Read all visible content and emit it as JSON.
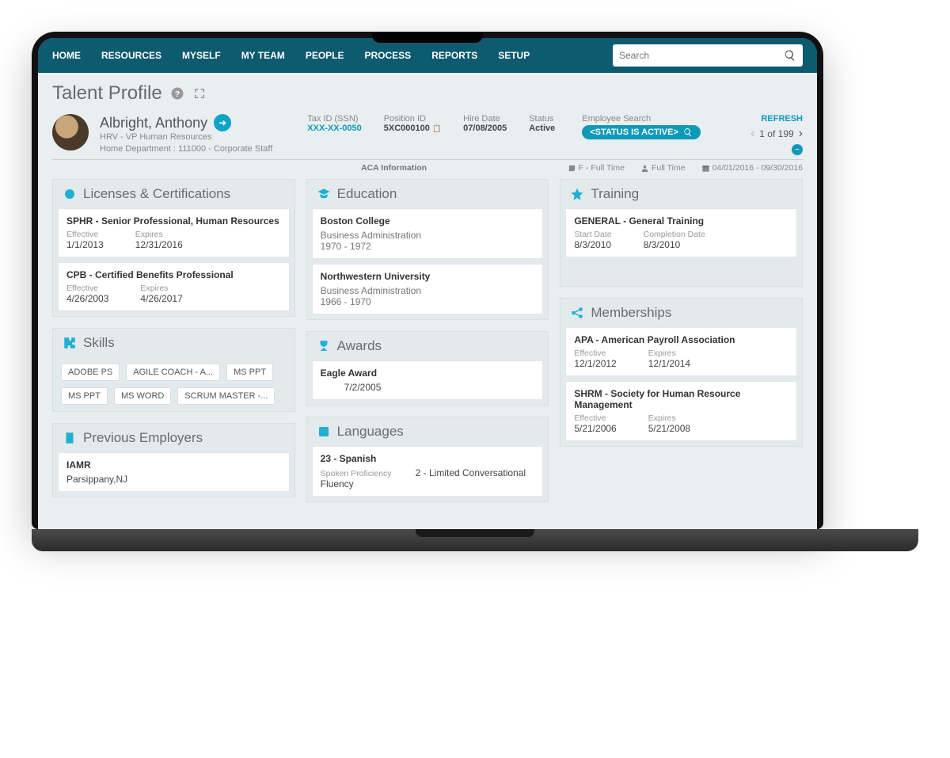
{
  "nav": [
    "HOME",
    "RESOURCES",
    "MYSELF",
    "MY TEAM",
    "PEOPLE",
    "PROCESS",
    "REPORTS",
    "SETUP"
  ],
  "search_placeholder": "Search",
  "page_title": "Talent Profile",
  "employee": {
    "name": "Albright, Anthony",
    "title": "HRV - VP Human Resources",
    "dept": "Home Department : 111000 - Corporate Staff"
  },
  "meta": {
    "tax_label": "Tax ID (SSN)",
    "tax_val": "XXX-XX-0050",
    "pos_label": "Position ID",
    "pos_val": "5XC000100",
    "hire_label": "Hire Date",
    "hire_val": "07/08/2005",
    "status_label": "Status",
    "status_val": "Active"
  },
  "emp_search": {
    "label": "Employee Search",
    "pill": "<STATUS IS ACTIVE>"
  },
  "refresh": "REFRESH",
  "pager": "1 of 199",
  "infobar": {
    "aca": "ACA Information",
    "ft1": "F - Full Time",
    "ft2": "Full Time",
    "range": "04/01/2016 - 09/30/2016"
  },
  "panels": {
    "licenses": {
      "title": "Licenses & Certifications",
      "items": [
        {
          "title": "SPHR - Senior Professional, Human Resources",
          "eff_l": "Effective",
          "eff": "1/1/2013",
          "exp_l": "Expires",
          "exp": "12/31/2016"
        },
        {
          "title": "CPB - Certified Benefits Professional",
          "eff_l": "Effective",
          "eff": "4/26/2003",
          "exp_l": "Expires",
          "exp": "4/26/2017"
        }
      ]
    },
    "skills": {
      "title": "Skills",
      "tags": [
        "ADOBE PS",
        "AGILE COACH - A...",
        "MS PPT",
        "MS PPT",
        "MS WORD",
        "SCRUM MASTER -..."
      ]
    },
    "prev": {
      "title": "Previous Employers",
      "item_title": "IAMR",
      "loc": "Parsippany,NJ"
    },
    "edu": {
      "title": "Education",
      "items": [
        {
          "school": "Boston College",
          "major": "Business Administration",
          "years": "1970 - 1972"
        },
        {
          "school": "Northwestern University",
          "major": "Business Administration",
          "years": "1966 - 1970"
        }
      ]
    },
    "awards": {
      "title": "Awards",
      "item": "Eagle Award",
      "date": "7/2/2005"
    },
    "lang": {
      "title": "Languages",
      "item": "23 - Spanish",
      "spk_l": "Spoken Proficiency",
      "spk": "2 - Limited Conversational Fluency"
    },
    "training": {
      "title": "Training",
      "item": "GENERAL - General Training",
      "sd_l": "Start Date",
      "sd": "8/3/2010",
      "cd_l": "Completion Date",
      "cd": "8/3/2010"
    },
    "memb": {
      "title": "Memberships",
      "items": [
        {
          "title": "APA - American Payroll Association",
          "eff_l": "Effective",
          "eff": "12/1/2012",
          "exp_l": "Expires",
          "exp": "12/1/2014"
        },
        {
          "title": "SHRM - Society for Human Resource Management",
          "eff_l": "Effective",
          "eff": "5/21/2006",
          "exp_l": "Expires",
          "exp": "5/21/2008"
        }
      ]
    }
  }
}
